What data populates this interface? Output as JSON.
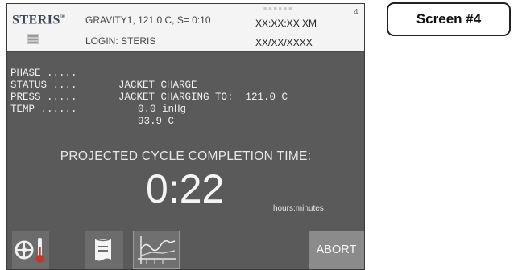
{
  "header": {
    "brand": "STERIS",
    "brand_mark": "®",
    "cycle_info": "GRAVITY1, 121.0 C, S= 0:10",
    "login": "LOGIN: STERIS",
    "time": "XX:XX:XX XM",
    "date": "XX/XX/XXXX",
    "screen_number": "4"
  },
  "status": {
    "phase": {
      "label": "PHASE .....",
      "value": "JACKET CHARGE"
    },
    "status": {
      "label": "STATUS ....",
      "value": "JACKET CHARGING TO:  121.0 C"
    },
    "press": {
      "label": "PRESS .....",
      "value": "0.0 inHg"
    },
    "temp": {
      "label": "TEMP ......",
      "value": "93.9 C"
    }
  },
  "projection": {
    "label": "PROJECTED CYCLE COMPLETION TIME:",
    "time": "0:22",
    "unit": "hours:minutes"
  },
  "buttons": {
    "abort": "ABORT"
  },
  "icons": {
    "sensor": "gauge-thermometer-icon",
    "document": "printout-icon",
    "graph": "cycle-graph-icon"
  },
  "screen_label": "Screen #4",
  "colors": {
    "screen_bg": "#5a5a5a",
    "header_bg": "#f4f4f4",
    "abort_bg": "#8b8b8b"
  }
}
